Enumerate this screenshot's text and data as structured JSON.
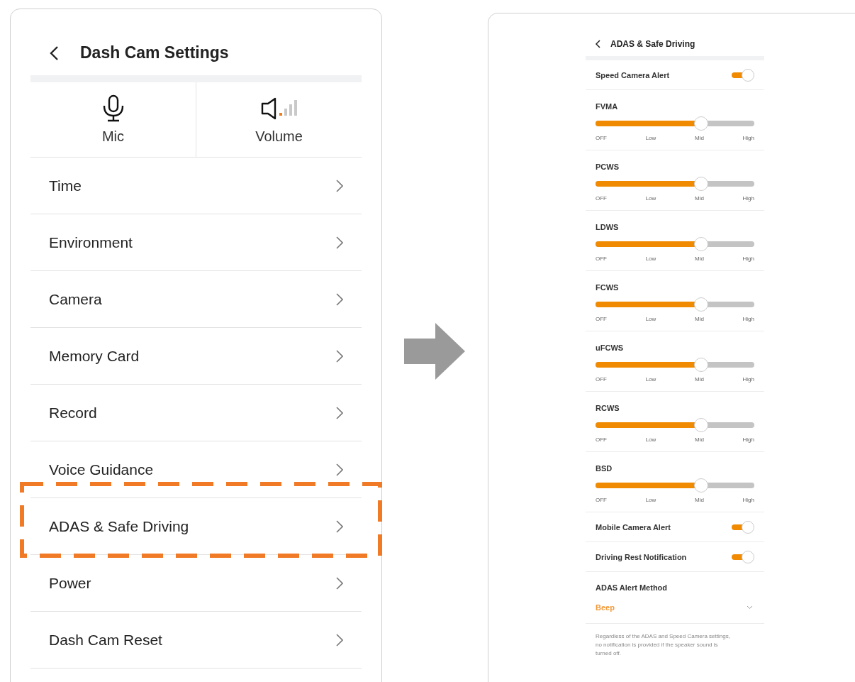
{
  "left_screen": {
    "title": "Dash Cam Settings",
    "quick_settings": [
      {
        "kind": "mic",
        "label": "Mic"
      },
      {
        "kind": "volume",
        "label": "Volume"
      }
    ],
    "menu": [
      {
        "label": "Time",
        "highlighted": false
      },
      {
        "label": "Environment",
        "highlighted": false
      },
      {
        "label": "Camera",
        "highlighted": false
      },
      {
        "label": "Memory Card",
        "highlighted": false
      },
      {
        "label": "Record",
        "highlighted": false
      },
      {
        "label": "Voice Guidance",
        "highlighted": false
      },
      {
        "label": "ADAS & Safe Driving",
        "highlighted": true
      },
      {
        "label": "Power",
        "highlighted": false
      },
      {
        "label": "Dash Cam Reset",
        "highlighted": false
      }
    ]
  },
  "right_screen": {
    "title": "ADAS & Safe Driving",
    "settings": [
      {
        "kind": "toggle",
        "label": "Speed Camera Alert",
        "on": true
      },
      {
        "kind": "slider",
        "label": "FVMA",
        "level": 0.667,
        "ticks": [
          "OFF",
          "Low",
          "Mid",
          "High"
        ]
      },
      {
        "kind": "slider",
        "label": "PCWS",
        "level": 0.667,
        "ticks": [
          "OFF",
          "Low",
          "Mid",
          "High"
        ]
      },
      {
        "kind": "slider",
        "label": "LDWS",
        "level": 0.667,
        "ticks": [
          "OFF",
          "Low",
          "Mid",
          "High"
        ]
      },
      {
        "kind": "slider",
        "label": "FCWS",
        "level": 0.667,
        "ticks": [
          "OFF",
          "Low",
          "Mid",
          "High"
        ]
      },
      {
        "kind": "slider",
        "label": "uFCWS",
        "level": 0.667,
        "ticks": [
          "OFF",
          "Low",
          "Mid",
          "High"
        ]
      },
      {
        "kind": "slider",
        "label": "RCWS",
        "level": 0.667,
        "ticks": [
          "OFF",
          "Low",
          "Mid",
          "High"
        ]
      },
      {
        "kind": "slider",
        "label": "BSD",
        "level": 0.667,
        "ticks": [
          "OFF",
          "Low",
          "Mid",
          "High"
        ]
      },
      {
        "kind": "toggle",
        "label": "Mobile Camera Alert",
        "on": true
      },
      {
        "kind": "toggle",
        "label": "Driving Rest Notification",
        "on": true
      },
      {
        "kind": "select",
        "label": "ADAS Alert Method",
        "value": "Beep"
      }
    ],
    "note": "Regardless of the ADAS and Speed Camera settings, no notification is provided if the speaker sound is turned off."
  }
}
